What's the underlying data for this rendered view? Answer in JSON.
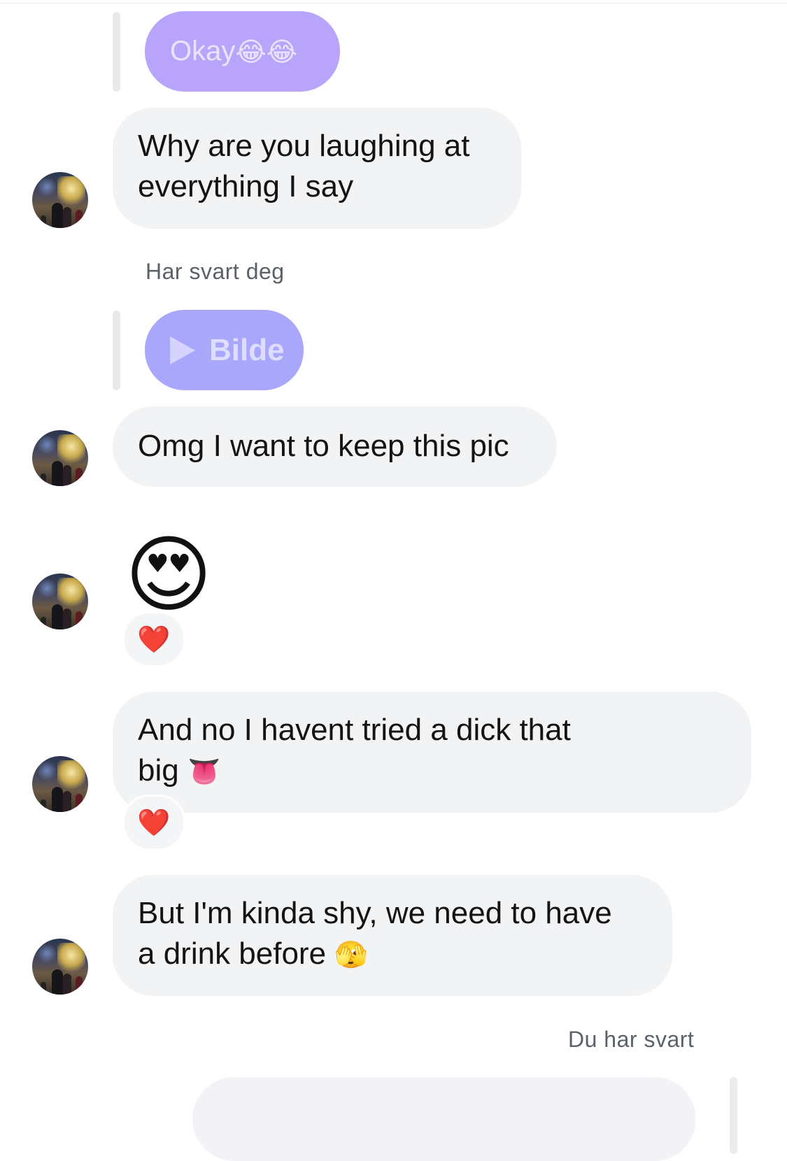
{
  "messages": [
    {
      "quoted_text": "Okay",
      "quoted_emoji": "😂😂"
    },
    {
      "text_line1": "Why are you laughing at",
      "text_line2": "everything I say"
    },
    {
      "reply_meta": "Har svart deg"
    },
    {
      "quoted_label": "Bilde",
      "quoted_icon": "play-icon"
    },
    {
      "text": "Omg I want to keep this pic"
    },
    {
      "big_emoji": "😍",
      "reaction": "❤️"
    },
    {
      "text_line1": "And no I havent tried a dick that",
      "text_line2": "big",
      "emoji": "👅",
      "reaction": "❤️"
    },
    {
      "text_line1": "But I'm kinda shy, we need to have",
      "text_line2": "a drink before",
      "emoji": "🫣"
    }
  ],
  "footer": {
    "reply_meta": "Du har svart"
  },
  "colors": {
    "quoted_bubble": "#b8a5fb",
    "quoted_media_bubble": "#a8a7fb",
    "incoming_bubble": "#f2f3f5",
    "reaction_heart": "#e0152a"
  }
}
